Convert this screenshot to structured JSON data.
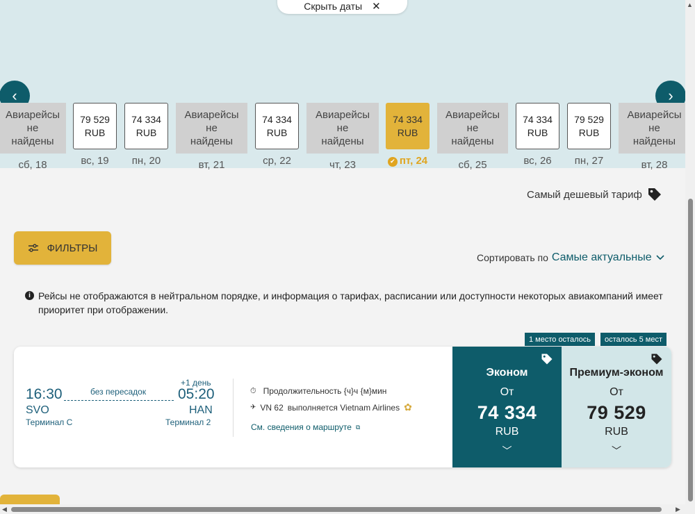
{
  "hide_dates_label": "Скрыть даты",
  "dates": [
    {
      "label": "сб, 18",
      "na": "Авиарейсы не найдены"
    },
    {
      "label": "вс, 19",
      "price": "79 529",
      "currency": "RUB"
    },
    {
      "label": "пн, 20",
      "price": "74 334",
      "currency": "RUB"
    },
    {
      "label": "вт, 21",
      "na": "Авиарейсы не найдены"
    },
    {
      "label": "ср, 22",
      "price": "74 334",
      "currency": "RUB"
    },
    {
      "label": "чт, 23",
      "na": "Авиарейсы не найдены"
    },
    {
      "label": "пт, 24",
      "price": "74 334",
      "currency": "RUB",
      "selected": true
    },
    {
      "label": "сб, 25",
      "na": "Авиарейсы не найдены"
    },
    {
      "label": "вс, 26",
      "price": "74 334",
      "currency": "RUB"
    },
    {
      "label": "пн, 27",
      "price": "79 529",
      "currency": "RUB"
    },
    {
      "label": "вт, 28",
      "na": "Авиарейсы не найдены"
    }
  ],
  "cheapest_label": "Самый дешевый тариф",
  "filters_label": "ФИЛЬТРЫ",
  "sort": {
    "label": "Сортировать по",
    "value": "Самые актуальные"
  },
  "notice": "Рейсы не отображаются в нейтральном порядке, и информация о тарифах, расписании или доступности некоторых авиакомпаний имеет приоритет при отображении.",
  "badges": {
    "economy": "1 место осталось",
    "premium": "осталось 5 мест"
  },
  "flight": {
    "dep_time": "16:30",
    "dep_code": "SVO",
    "dep_terminal": "Терминал C",
    "stops": "без пересадок",
    "next_day": "+1 день",
    "arr_time": "05:20",
    "arr_code": "HAN",
    "arr_terminal": "Терминал 2",
    "duration": "Продолжительность {ч}ч {м}мин",
    "flight_no": "VN 62",
    "operated_by": "выполняется Vietnam Airlines",
    "route_link": "См. сведения о маршруте"
  },
  "fares": {
    "economy": {
      "name": "Эконом",
      "from": "От",
      "amount": "74 334",
      "currency": "RUB"
    },
    "premium": {
      "name": "Премиум-эконом",
      "from": "От",
      "amount": "79 529",
      "currency": "RUB"
    }
  },
  "colors": {
    "teal": "#0e5c6a",
    "gold": "#e2b33a",
    "light_teal": "#d2e6e8"
  }
}
